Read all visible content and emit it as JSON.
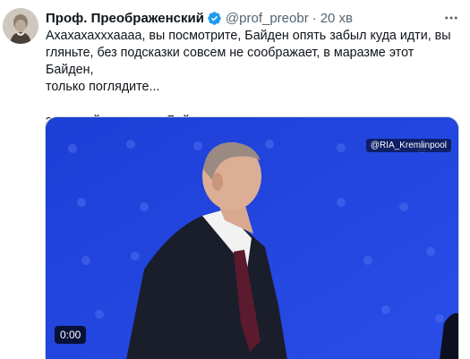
{
  "tweet": {
    "author_name": "Проф. Преображенский",
    "handle": "@prof_preobr",
    "separator": "·",
    "time": "20 хв",
    "text_lines": [
      "Ахахахахххаааа, вы посмотрите, Байден опять забыл куда идти, вы",
      "гляньте, без подсказки совсем не соображает, в маразме этот Байден,",
      "только поглядите..."
    ],
    "text_second": "ээээ... ой, это же не Байден...",
    "verified_color": "#1d9bf0",
    "icons": {
      "verified": "verified-badge-icon",
      "more": "more-dots-icon"
    }
  },
  "media": {
    "watermark": "@RIA_Kremlinpool",
    "duration": "0:00",
    "type": "video"
  }
}
